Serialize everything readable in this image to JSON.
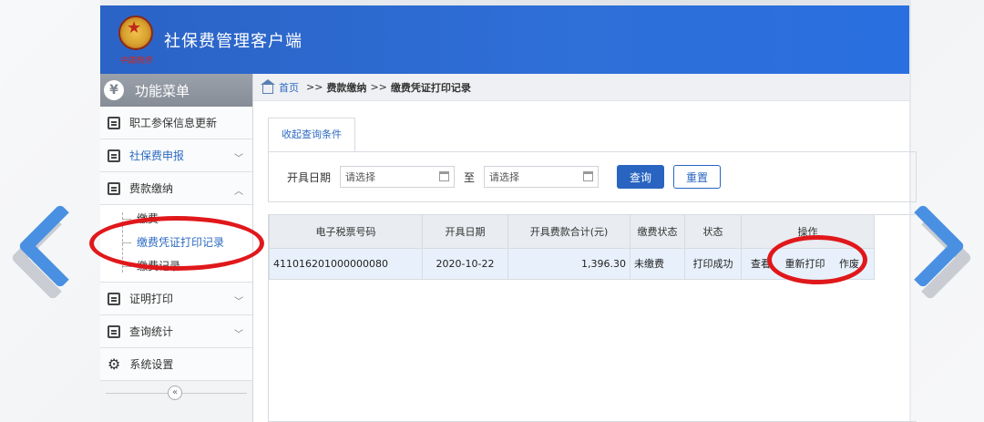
{
  "app": {
    "title": "社保费管理客户端",
    "emblem_text": "中国税务"
  },
  "sidebar": {
    "header": "功能菜单",
    "items": [
      {
        "label": "职工参保信息更新",
        "icon": "list-icon",
        "expanded": false,
        "has_chevron": false
      },
      {
        "label": "社保费申报",
        "icon": "calendar-icon",
        "expanded": false,
        "has_chevron": true
      },
      {
        "label": "费款缴纳",
        "icon": "wallet-icon",
        "expanded": true,
        "has_chevron": true
      },
      {
        "label": "证明打印",
        "icon": "print-icon",
        "expanded": false,
        "has_chevron": true
      },
      {
        "label": "查询统计",
        "icon": "chart-icon",
        "expanded": false,
        "has_chevron": true
      },
      {
        "label": "系统设置",
        "icon": "gear-icon",
        "expanded": false,
        "has_chevron": false
      }
    ],
    "submenu": [
      "缴费",
      "缴费凭证打印记录",
      "缴费记录"
    ],
    "collapse_symbol": "«"
  },
  "breadcrumb": {
    "home": "首页",
    "sep": ">>",
    "level1": "费款缴纳",
    "current": "缴费凭证打印记录"
  },
  "query": {
    "tab_label": "收起查询条件",
    "date_label": "开具日期",
    "start_placeholder": "请选择",
    "to_label": "至",
    "end_placeholder": "请选择",
    "query_button": "查询",
    "reset_button": "重置"
  },
  "table": {
    "headers": [
      "电子税票号码",
      "开具日期",
      "开具费款合计(元)",
      "缴费状态",
      "状态",
      "操作"
    ],
    "rows": [
      {
        "ticket_no": "411016201000000080",
        "date": "2020-10-22",
        "total": "1,396.30",
        "pay_status": "未缴费",
        "status": "打印成功",
        "actions": [
          "查看",
          "重新打印",
          "作废"
        ]
      }
    ]
  },
  "colors": {
    "header_blue": "#2e6fd8",
    "accent": "#2864c0",
    "annotation_red": "#e0181b"
  }
}
